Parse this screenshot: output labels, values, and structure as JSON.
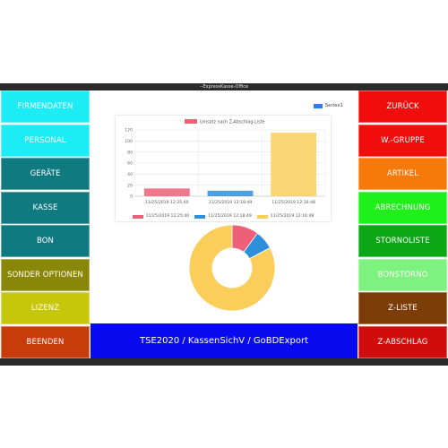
{
  "window": {
    "title": "--ExpressKasse-Office"
  },
  "left_buttons": [
    {
      "label": "FIRMENDATEN",
      "bg": "#1cecf5",
      "fg": "#ffffff"
    },
    {
      "label": "PERSONAL",
      "bg": "#1cecf5",
      "fg": "#ffffff"
    },
    {
      "label": "GERÄTE",
      "bg": "#0f7a80",
      "fg": "#ffffff"
    },
    {
      "label": "KASSE",
      "bg": "#0f7a80",
      "fg": "#ffffff"
    },
    {
      "label": "BON",
      "bg": "#0f7a80",
      "fg": "#ffffff"
    },
    {
      "label": "SONDER OPTIONEN",
      "bg": "#8a8708",
      "fg": "#ffffff"
    },
    {
      "label": "LIZENZ",
      "bg": "#c6c70b",
      "fg": "#ffffff"
    },
    {
      "label": "BEENDEN",
      "bg": "#c83c0b",
      "fg": "#ffffff"
    }
  ],
  "right_buttons": [
    {
      "label": "ZURÜCK",
      "bg": "#f20d0d",
      "fg": "#ffffff"
    },
    {
      "label": "W.-GRUPPE",
      "bg": "#f20d0d",
      "fg": "#ffffff"
    },
    {
      "label": "ARTIKEL",
      "bg": "#f6790a",
      "fg": "#ffffff"
    },
    {
      "label": "ABRECHNUNG",
      "bg": "#1ef01a",
      "fg": "#ffffff"
    },
    {
      "label": "STORNOLISTE",
      "bg": "#0da616",
      "fg": "#ffffff"
    },
    {
      "label": "BONSTORNO",
      "bg": "#7ef27e",
      "fg": "#ffffff"
    },
    {
      "label": "Z-LISTE",
      "bg": "#7d3d08",
      "fg": "#ffffff"
    },
    {
      "label": "Z-ABSCHLAG",
      "bg": "#d00d0d",
      "fg": "#ffffff"
    }
  ],
  "tse_button": {
    "label": "TSE2020 / KassenSichV / GoBDExport",
    "bg": "#0a0af0",
    "fg": "#ffffff"
  },
  "top_legend": {
    "label": "Series1",
    "color": "#2f80d9"
  },
  "chart_data": {
    "type": "bar",
    "title": "Umsatz nach Z-Abschlag-Liste",
    "categories": [
      "11/25/2019 12:25:40",
      "11/25/2019 12:18:49",
      "11/25/2019 12:16:48"
    ],
    "values": [
      14,
      10,
      115
    ],
    "colors": [
      "#ee5f78",
      "#2f8fdc",
      "#fbce5c"
    ],
    "ylim": [
      0,
      120
    ],
    "yticks": [
      0,
      20,
      40,
      60,
      80,
      100,
      120
    ],
    "grid": true,
    "legend_entries": [
      "11/25/2019 12:25:40",
      "11/25/2019 12:18:49",
      "11/25/2019 12:16:48"
    ]
  },
  "pie_data": {
    "type": "pie",
    "values": [
      14,
      10,
      115
    ],
    "colors": [
      "#ee5f78",
      "#2f8fdc",
      "#fbce5c"
    ]
  }
}
